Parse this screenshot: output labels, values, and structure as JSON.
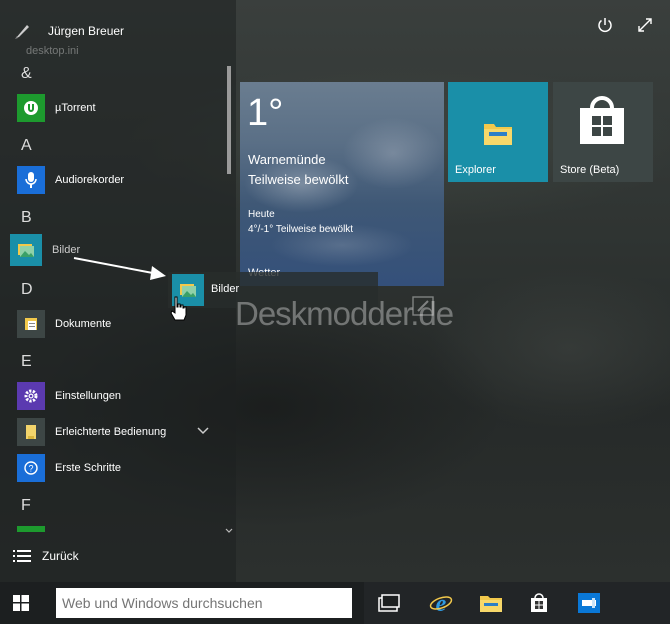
{
  "user": {
    "name": "Jürgen Breuer"
  },
  "faint_text": "desktop.ini",
  "groups": [
    {
      "letter": "&",
      "apps": [
        {
          "label": "µTorrent",
          "icon": "utorrent-icon",
          "color": "#1d9a2e"
        }
      ]
    },
    {
      "letter": "A",
      "apps": [
        {
          "label": "Audiorekorder",
          "icon": "microphone-icon",
          "color": "#1a6ed8"
        }
      ]
    },
    {
      "letter": "B",
      "apps": [
        {
          "label": "Bilder",
          "icon": "pictures-icon",
          "color": "#1a8fa8"
        }
      ]
    },
    {
      "letter": "D",
      "apps": [
        {
          "label": "Dokumente",
          "icon": "documents-icon",
          "color": "#3d4645"
        }
      ]
    },
    {
      "letter": "E",
      "apps": [
        {
          "label": "Einstellungen",
          "icon": "gear-icon",
          "color": "#5b3ab0"
        },
        {
          "label": "Erleichterte Bedienung",
          "icon": "ease-of-access-icon",
          "color": "#3d4645"
        },
        {
          "label": "Erste Schritte",
          "icon": "help-icon",
          "color": "#1a6ed8"
        }
      ]
    },
    {
      "letter": "F",
      "apps": []
    }
  ],
  "back_label": "Zurück",
  "weather": {
    "temp": "1°",
    "city": "Warnemünde",
    "condition": "Teilweise bewölkt",
    "today_label": "Heute",
    "today_range": "4°/-1° Teilweise bewölkt",
    "name": "Wetter"
  },
  "tiles": {
    "explorer": {
      "label": "Explorer",
      "color": "#1a8fa8"
    },
    "store": {
      "label": "Store (Beta)",
      "color": "#3d4645"
    }
  },
  "drag_ghost": {
    "label": "Bilder"
  },
  "watermark": "Deskmodder.de",
  "search": {
    "placeholder": "Web und Windows durchsuchen"
  },
  "taskbar_icons": [
    "task-view-icon",
    "internet-explorer-icon",
    "file-explorer-icon",
    "store-icon",
    "app-icon"
  ]
}
